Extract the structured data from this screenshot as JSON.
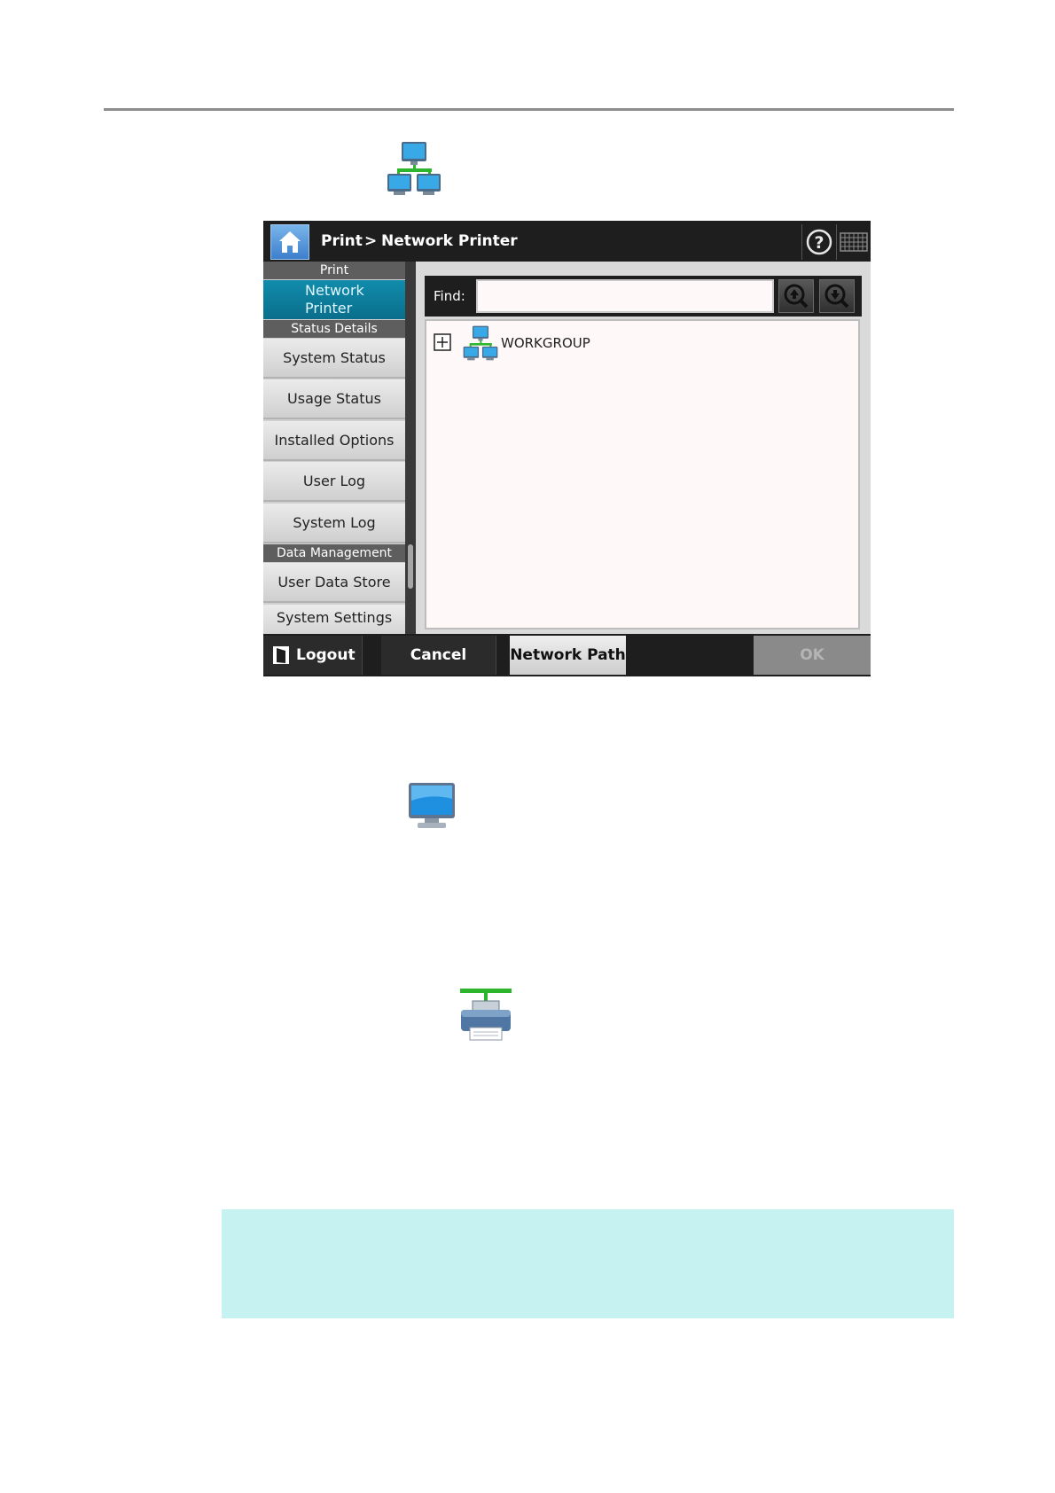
{
  "breadcrumb": {
    "item1": "Print",
    "separator": ">",
    "item2": "Network Printer"
  },
  "sidebar": {
    "section_print": "Print",
    "selected_item": {
      "line1": "Network",
      "line2": "Printer"
    },
    "section_status": "Status Details",
    "status_items": [
      "System Status",
      "Usage Status",
      "Installed Options",
      "User Log",
      "System Log"
    ],
    "section_data": "Data Management",
    "data_items": [
      "User Data Store",
      "System Settings"
    ]
  },
  "find": {
    "label": "Find:",
    "value": ""
  },
  "tree": {
    "items": [
      {
        "label": "WORKGROUP",
        "icon": "workgroup-icon"
      }
    ]
  },
  "bottom": {
    "logout": "Logout",
    "cancel": "Cancel",
    "network_path": "Network Path",
    "ok": "OK"
  },
  "icons": {
    "doc": [
      "workgroup-icon",
      "computer-icon",
      "network-printer-icon"
    ],
    "toolbar": [
      "home-icon",
      "help-icon",
      "keyboard-icon",
      "find-previous-icon",
      "find-next-icon",
      "logout-icon",
      "expand-icon"
    ]
  },
  "colors": {
    "selected": "#0a7b9b",
    "note_background": "#c6f3f1",
    "screen_dark": "#1e1e1e",
    "network_green": "#28c028"
  }
}
